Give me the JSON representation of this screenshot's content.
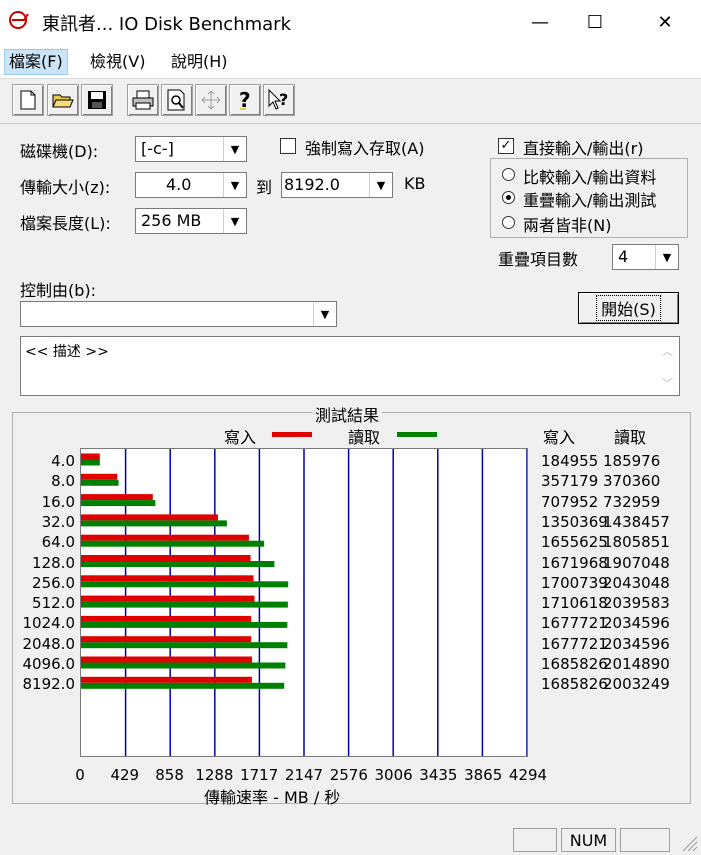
{
  "window": {
    "title": "東訊者... IO Disk Benchmark",
    "minimize": "—",
    "maximize": "☐",
    "close": "✕"
  },
  "menu": [
    "檔案(F)",
    "檢視(V)",
    "說明(H)"
  ],
  "toolbar_icons": [
    "new-file-icon",
    "open-folder-icon",
    "save-icon",
    "print-icon",
    "print-preview-icon",
    "move-icon",
    "help-icon",
    "context-help-icon"
  ],
  "form": {
    "drive_label": "磁碟機(D):",
    "drive_value": "[-c-]",
    "force_write_label": "強制寫入存取(A)",
    "transfer_label": "傳輸大小(z):",
    "transfer_from": "4.0",
    "to_label": "到",
    "transfer_to": "8192.0",
    "unit": "KB",
    "file_length_label": "檔案長度(L):",
    "file_length_value": "256 MB",
    "direct_io_label": "直接輸入/輸出(r)",
    "direct_io_checked": true,
    "radio_compare": "比較輸入/輸出資料",
    "radio_overlap": "重疊輸入/輸出測試",
    "radio_neither": "兩者皆非(N)",
    "selected_radio": "radio_overlap",
    "queue_label": "重疊項目數",
    "queue_value": "4",
    "control_label": "控制由(b):",
    "control_value": "",
    "start_button": "開始(S)",
    "description": "<< 描述 >>"
  },
  "results": {
    "group_title": "測試結果",
    "legend_write": "寫入",
    "legend_read": "讀取",
    "col_write": "寫入",
    "col_read": "讀取",
    "rows": [
      {
        "size": "4.0",
        "write": "184955",
        "read": "185976"
      },
      {
        "size": "8.0",
        "write": "357179",
        "read": "370360"
      },
      {
        "size": "16.0",
        "write": "707952",
        "read": "732959"
      },
      {
        "size": "32.0",
        "write": "1350369",
        "read": "1438457"
      },
      {
        "size": "64.0",
        "write": "1655625",
        "read": "1805851"
      },
      {
        "size": "128.0",
        "write": "1671968",
        "read": "1907048"
      },
      {
        "size": "256.0",
        "write": "1700739",
        "read": "2043048"
      },
      {
        "size": "512.0",
        "write": "1710618",
        "read": "2039583"
      },
      {
        "size": "1024.0",
        "write": "1677721",
        "read": "2034596"
      },
      {
        "size": "2048.0",
        "write": "1677721",
        "read": "2034596"
      },
      {
        "size": "4096.0",
        "write": "1685826",
        "read": "2014890"
      },
      {
        "size": "8192.0",
        "write": "1685826",
        "read": "2003249"
      }
    ]
  },
  "chart_data": {
    "type": "bar",
    "orientation": "horizontal",
    "categories": [
      "4.0",
      "8.0",
      "16.0",
      "32.0",
      "64.0",
      "128.0",
      "256.0",
      "512.0",
      "1024.0",
      "2048.0",
      "4096.0",
      "8192.0"
    ],
    "series": [
      {
        "name": "寫入",
        "color": "#e00000",
        "values": [
          180.6,
          348.8,
          691.4,
          1318.7,
          1616.8,
          1632.8,
          1660.9,
          1670.5,
          1638.4,
          1638.4,
          1646.3,
          1646.3
        ]
      },
      {
        "name": "讀取",
        "color": "#008000",
        "values": [
          181.6,
          361.7,
          715.8,
          1404.7,
          1763.5,
          1862.3,
          1995.2,
          1991.8,
          1987.0,
          1987.0,
          1967.7,
          1956.3
        ]
      }
    ],
    "xticks": [
      "0",
      "429",
      "858",
      "1288",
      "1717",
      "2147",
      "2576",
      "3006",
      "3435",
      "3865",
      "4294"
    ],
    "xlim": [
      0,
      4294
    ],
    "xlabel": "傳輸速率 - MB / 秒",
    "grid": "vertical",
    "gridline_color": "#0000b0"
  },
  "status": {
    "num": "NUM"
  }
}
